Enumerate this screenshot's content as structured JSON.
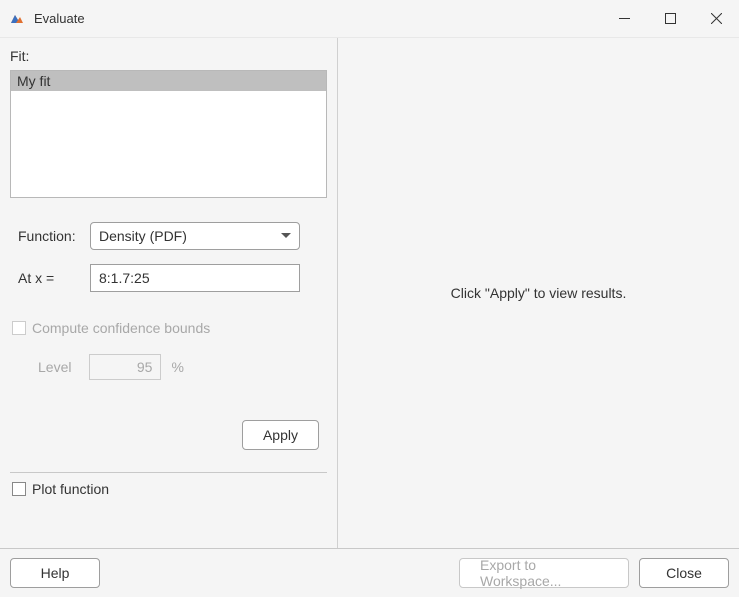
{
  "window": {
    "title": "Evaluate"
  },
  "left": {
    "fit_label": "Fit:",
    "fits": [
      "My fit"
    ],
    "function_label": "Function:",
    "function_value": "Density (PDF)",
    "atx_label": "At x =",
    "atx_value": "8:1.7:25",
    "confidence_label": "Compute confidence bounds",
    "level_label": "Level",
    "level_value": "95",
    "level_pct": "%",
    "apply_label": "Apply",
    "plot_label": "Plot function"
  },
  "right": {
    "message": "Click \"Apply\" to view results."
  },
  "bottom": {
    "help_label": "Help",
    "export_label": "Export to Workspace...",
    "close_label": "Close"
  }
}
